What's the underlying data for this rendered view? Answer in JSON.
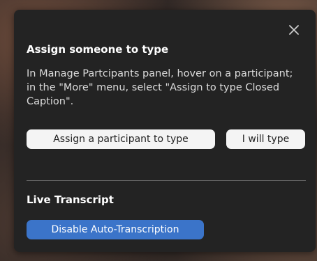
{
  "popup": {
    "close_icon": "close-icon",
    "assign_section": {
      "title": "Assign someone to type",
      "description": "In Manage Partcipants panel, hover on a participant; in the \"More\" menu, select \"Assign to type Closed Caption\".",
      "assign_button_label": "Assign a participant to type",
      "self_button_label": "I will type"
    },
    "transcript_section": {
      "title": "Live Transcript",
      "disable_button_label": "Disable Auto-Transcription"
    }
  },
  "colors": {
    "panel_background": "#232323",
    "primary_button": "#3b74c9",
    "secondary_button": "#f4f4f4"
  }
}
